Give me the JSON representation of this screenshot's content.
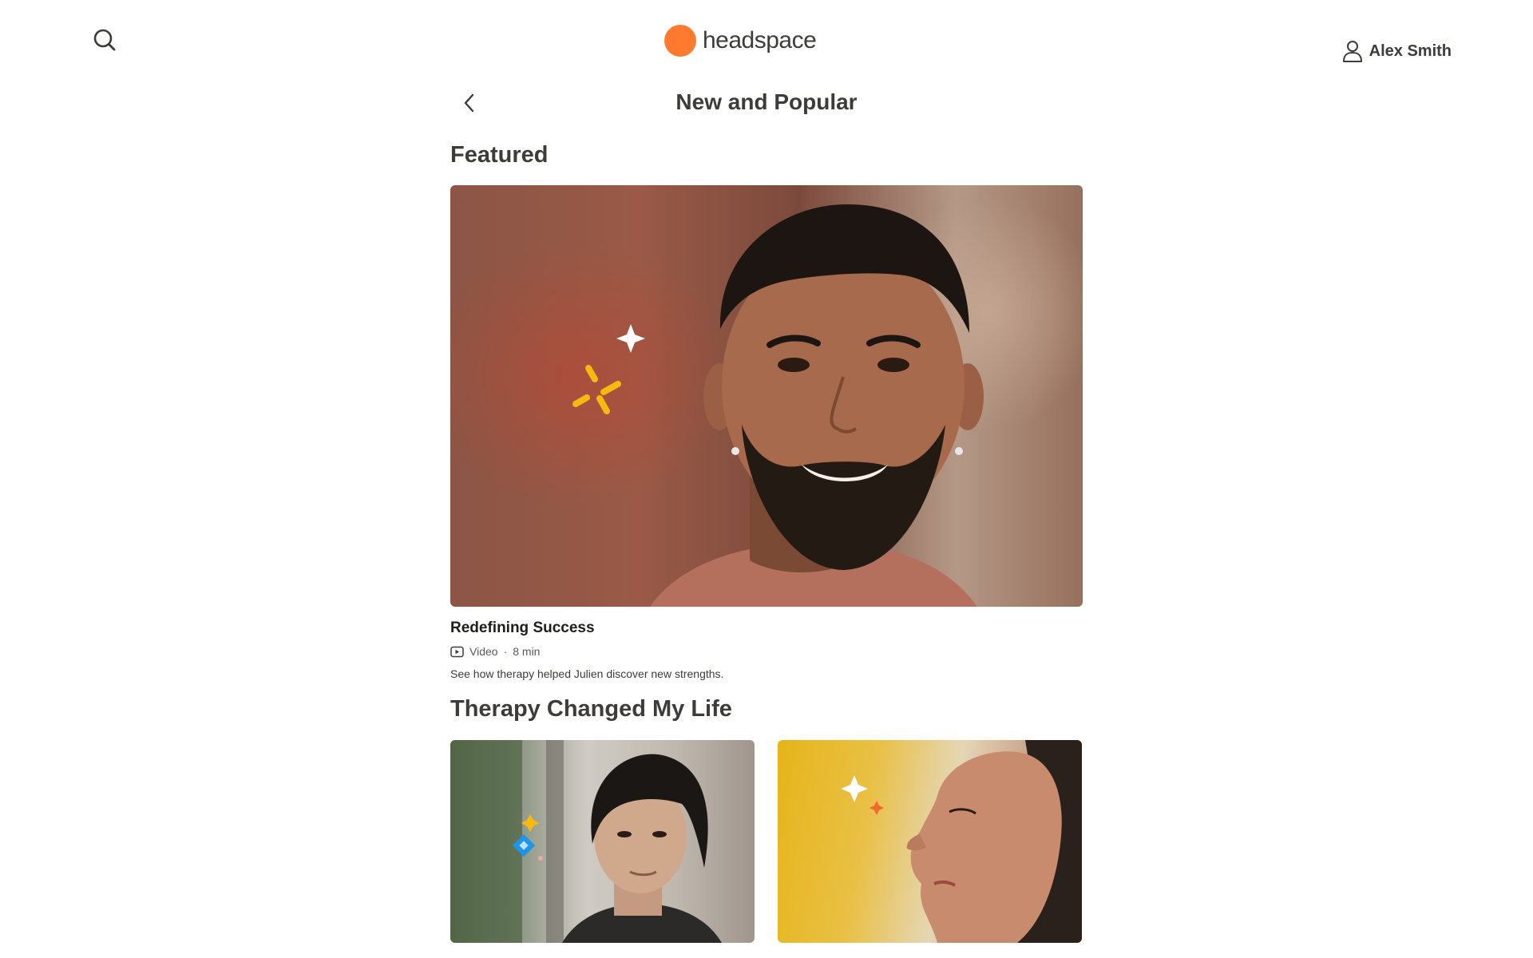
{
  "header": {
    "brand": "headspace",
    "user_name": "Alex Smith",
    "icons": {
      "search": "search-icon",
      "user": "user-icon",
      "back": "chevron-left-icon"
    }
  },
  "page": {
    "title": "New and Popular"
  },
  "featured": {
    "heading": "Featured",
    "card": {
      "title": "Redefining Success",
      "type": "Video",
      "duration": "8 min",
      "meta_separator": "·",
      "description": "See how therapy helped Julien discover new strengths."
    }
  },
  "therapy": {
    "heading": "Therapy Changed My Life"
  },
  "colors": {
    "brand_orange": "#ff7a2f",
    "text_dark": "#3d3c3b",
    "accent_yellow": "#f6b90f",
    "accent_blue": "#1d95e8"
  }
}
